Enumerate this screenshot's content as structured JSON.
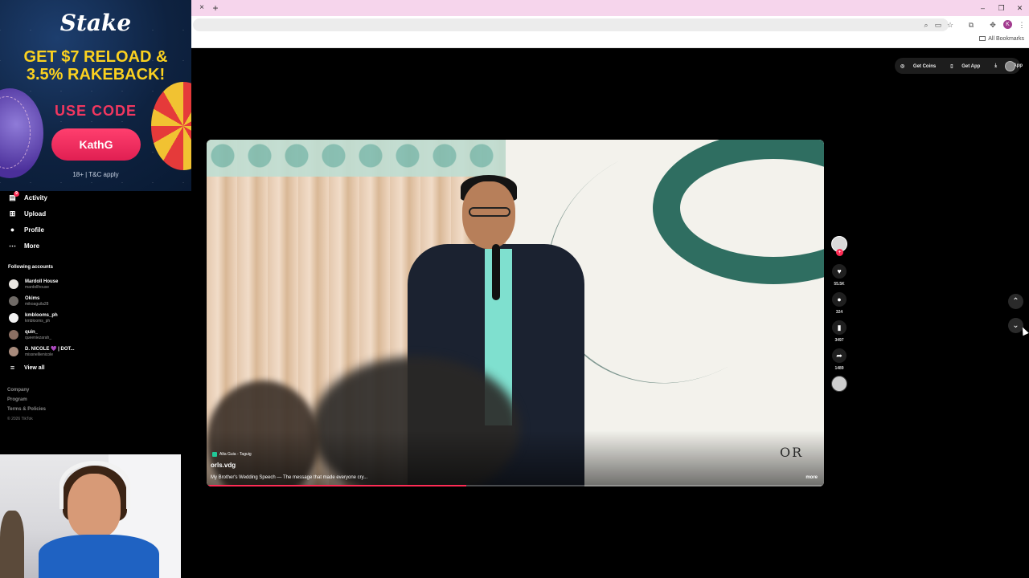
{
  "browser": {
    "new_tab_symbol": "+",
    "close_tab_symbol": "×",
    "window_controls": [
      "–",
      "❐",
      "✕"
    ],
    "profile_initial": "K",
    "all_bookmarks": "All Bookmarks",
    "toolbar_icons": [
      "search-icon",
      "cast-icon",
      "star-icon",
      "extensions-icon",
      "puzzle-icon",
      "menu-icon"
    ]
  },
  "ad": {
    "brand": "Stake",
    "headline_line1": "GET $7 RELOAD &",
    "headline_line2": "3.5% RAKEBACK!",
    "use_code": "USE CODE",
    "code": "KathG",
    "fine_print": "18+ | T&C apply",
    "colors": {
      "headline": "#fbd11f",
      "accent": "#f2375f",
      "background": "#0e2240"
    }
  },
  "sidebar": {
    "nav": [
      {
        "label": "Activity",
        "icon": "inbox-icon",
        "badge": "9"
      },
      {
        "label": "Upload",
        "icon": "plus-square-icon"
      },
      {
        "label": "Profile",
        "icon": "profile-avatar-icon"
      },
      {
        "label": "More",
        "icon": "more-dots-icon"
      }
    ],
    "following_title": "Following accounts",
    "following": [
      {
        "name": "Mardoll House",
        "handle": "mardollhouse"
      },
      {
        "name": "Okims",
        "handle": "mikoaguila28"
      },
      {
        "name": "kmblooms_ph",
        "handle": "kmblooms_ph"
      },
      {
        "name": "quin_",
        "handle": "queeniezarah_"
      },
      {
        "name": "D. NICOLE 💜 | DOT...",
        "handle": "missnellienicole"
      }
    ],
    "view_all": "View all",
    "footer": [
      "Company",
      "Program",
      "Terms & Policies"
    ],
    "copyright": "© 2026 TikTok"
  },
  "top_actions": {
    "get_coins": "Get Coins",
    "get_app": "Get App",
    "pc_app": "PC App"
  },
  "video": {
    "location": "Alta Guia - Taguig",
    "author": "orls.vdg",
    "caption": "My Brother's Wedding Speech — The message that made everyone cry...",
    "more": "more",
    "backdrop_text": "OR",
    "progress_percent": 42
  },
  "actions": {
    "likes": "55.5K",
    "comments": "324",
    "saves": "3497",
    "shares": "1489"
  },
  "navigation": {
    "prev_icon": "chevron-up-icon",
    "next_icon": "chevron-down-icon"
  }
}
